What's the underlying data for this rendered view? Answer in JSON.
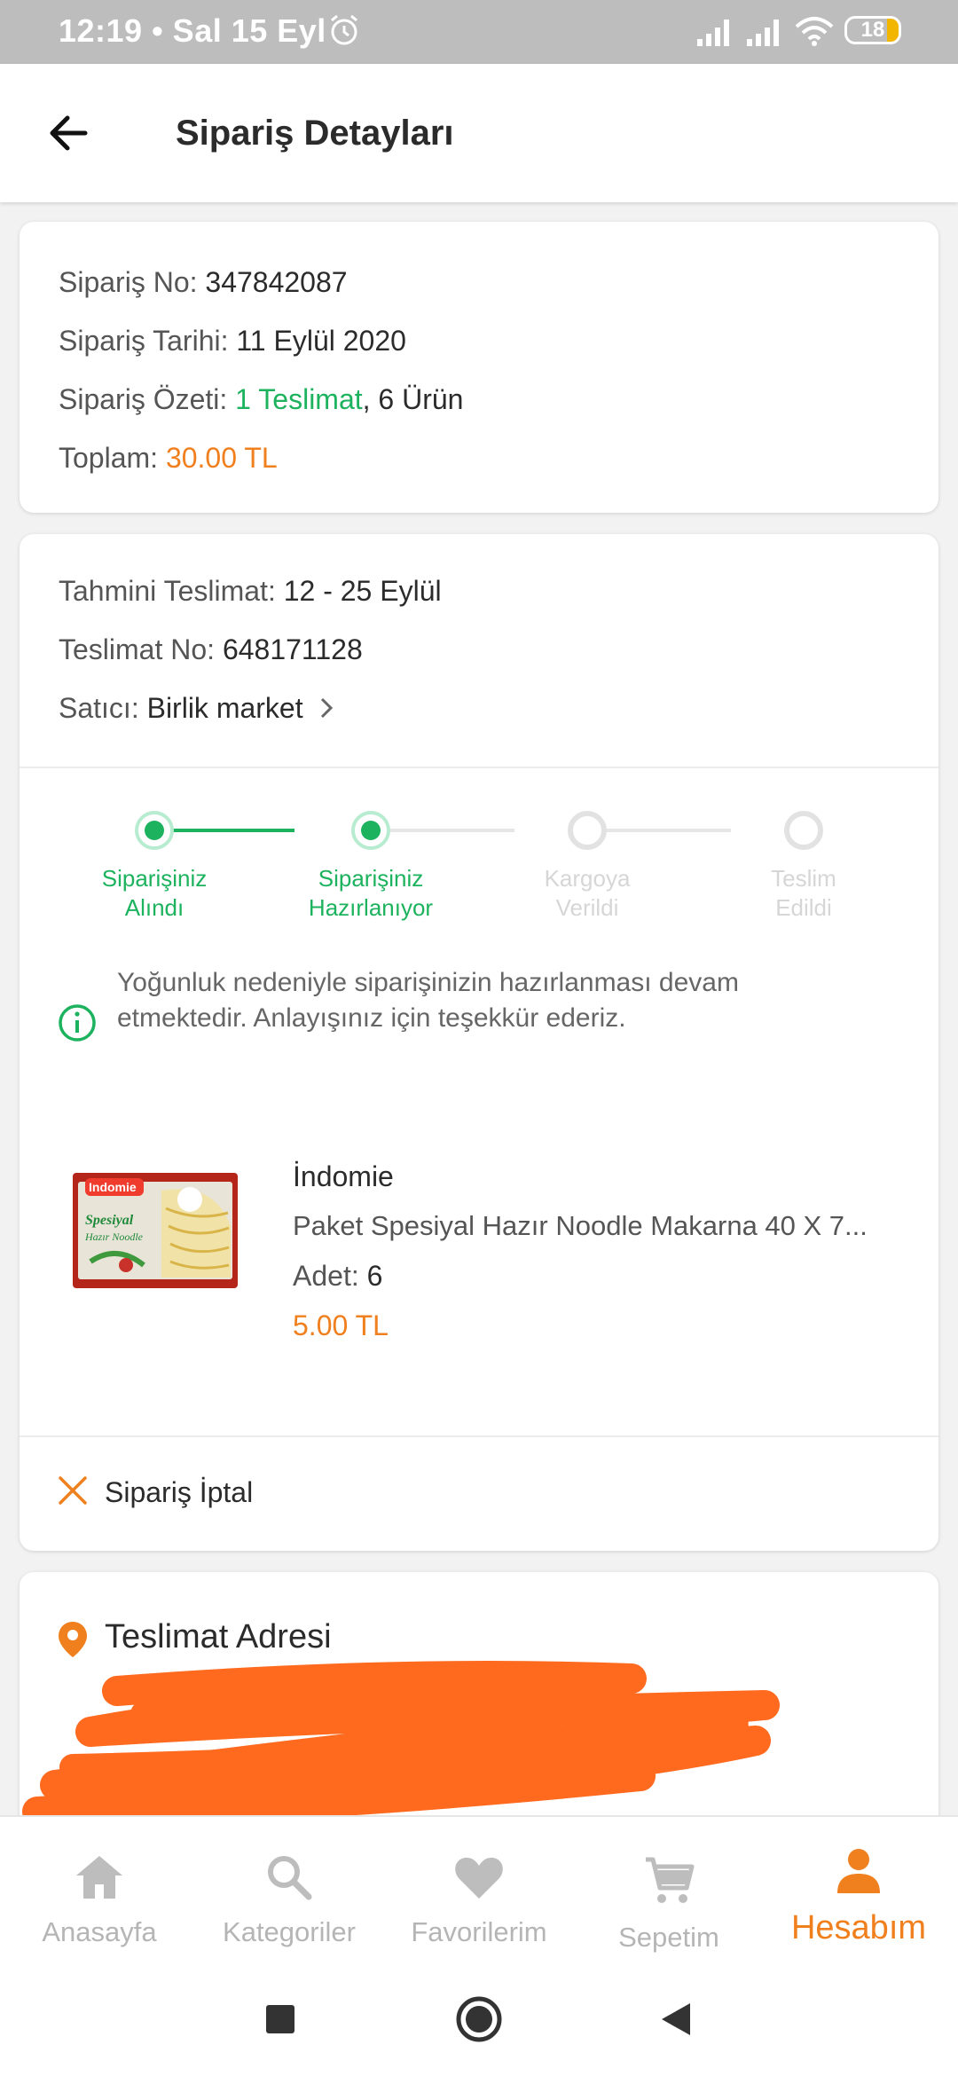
{
  "status": {
    "time": "12:19 • Sal 15 Eyl",
    "battery": "18"
  },
  "appbar": {
    "title": "Sipariş Detayları"
  },
  "order": {
    "no_label": "Sipariş No:",
    "no_value": "347842087",
    "date_label": "Sipariş Tarihi:",
    "date_value": "11 Eylül 2020",
    "summary_label": "Sipariş Özeti:",
    "summary_deliveries": "1 Teslimat",
    "summary_items": ", 6 Ürün",
    "total_label": "Toplam:",
    "total_value": "30.00 TL"
  },
  "delivery": {
    "eta_label": "Tahmini Teslimat:",
    "eta_value": "12 - 25 Eylül",
    "no_label": "Teslimat No:",
    "no_value": "648171128",
    "seller_label": "Satıcı:",
    "seller_value": "Birlik market",
    "steps": [
      {
        "line1": "Siparişiniz",
        "line2": "Alındı",
        "done": true
      },
      {
        "line1": "Siparişiniz",
        "line2": "Hazırlanıyor",
        "done": true
      },
      {
        "line1": "Kargoya",
        "line2": "Verildi",
        "done": false
      },
      {
        "line1": "Teslim",
        "line2": "Edildi",
        "done": false
      }
    ],
    "info_line1": "Yoğunluk nedeniyle siparişinizin hazırlanması devam",
    "info_line2": "etmektedir. Anlayışınız için teşekkür ederiz.",
    "product": {
      "brand": "İndomie",
      "name": "Paket Spesiyal Hazır Noodle Makarna 40 X 7...",
      "qty_label": "Adet:",
      "qty_value": "6",
      "price": "5.00 TL",
      "image_text_1": "Indomie",
      "image_text_2": "Spesiyal",
      "image_text_3": "Hazır Noodle"
    },
    "cancel_label": "Sipariş İptal"
  },
  "address": {
    "title": "Teslimat Adresi"
  },
  "nav": {
    "items": [
      {
        "label": "Anasayfa",
        "icon": "home-icon"
      },
      {
        "label": "Kategoriler",
        "icon": "search-icon"
      },
      {
        "label": "Favorilerim",
        "icon": "heart-icon"
      },
      {
        "label": "Sepetim",
        "icon": "cart-icon"
      },
      {
        "label": "Hesabım",
        "icon": "person-icon"
      }
    ],
    "active_index": 4
  },
  "colors": {
    "accent_orange": "#f07f1e",
    "success_green": "#1db35e",
    "redaction": "#ff6a1f"
  }
}
